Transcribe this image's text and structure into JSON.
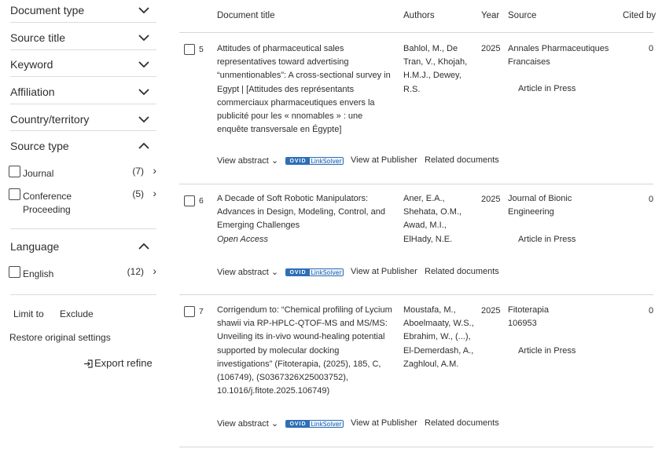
{
  "sidebar": {
    "facets": [
      {
        "label": "Document type",
        "expanded": false
      },
      {
        "label": "Source title",
        "expanded": false
      },
      {
        "label": "Keyword",
        "expanded": false
      },
      {
        "label": "Affiliation",
        "expanded": false
      },
      {
        "label": "Country/territory",
        "expanded": false
      },
      {
        "label": "Source type",
        "expanded": true
      },
      {
        "label": "Language",
        "expanded": true
      }
    ],
    "source_type_options": [
      {
        "label": "Journal",
        "count": "(7)"
      },
      {
        "label": "Conference Proceeding",
        "count": "(5)"
      }
    ],
    "language_options": [
      {
        "label": "English",
        "count": "(12)"
      }
    ],
    "limit_to": "Limit to",
    "exclude": "Exclude",
    "restore": "Restore original settings",
    "export_refine": "Export refine"
  },
  "table": {
    "headers": {
      "title": "Document title",
      "authors": "Authors",
      "year": "Year",
      "source": "Source",
      "cited": "Cited by"
    }
  },
  "actions": {
    "view_abstract": "View abstract",
    "ovid_left": "OVID",
    "ovid_right": "LinkSolver",
    "view_publisher": "View at Publisher",
    "related": "Related documents"
  },
  "results": [
    {
      "num": "5",
      "title": "Attitudes of pharmaceutical sales representatives toward advertising “unmentionables”: A cross-sectional survey in Egypt | [Attitudes des représentants commerciaux pharmaceutiques envers la publicité pour les « nnomables » : une enquête transversale en Égypte]",
      "open_access": "",
      "authors": "Bahlol, M., De Tran, V., Khojah, H.M.J., Dewey, R.S.",
      "year": "2025",
      "source": "Annales Pharmaceutiques Francaises",
      "status": "Article in Press",
      "cited": "0"
    },
    {
      "num": "6",
      "title": "A Decade of Soft Robotic Manipulators: Advances in Design, Modeling, Control, and Emerging Challenges",
      "open_access": "Open Access",
      "authors": "Aner, E.A., Shehata, O.M., Awad, M.I., ElHady, N.E.",
      "year": "2025",
      "source": "Journal of Bionic Engineering",
      "status": "Article in Press",
      "cited": "0"
    },
    {
      "num": "7",
      "title": "Corrigendum to: “Chemical profiling of Lycium shawii via RP-HPLC-QTOF-MS and MS/MS: Unveiling its in-vivo wound-healing potential supported by molecular docking investigations” (Fitoterapia, (2025), 185, C, (106749), (S0367326X25003752), 10.1016/j.fitote.2025.106749)",
      "open_access": "",
      "authors": "Moustafa, M., Aboelmaaty, W.S., Ebrahim, W., (...), El-Demerdash, A., Zaghloul, A.M.",
      "year": "2025",
      "source": "Fitoterapia 106953",
      "status": "Article in Press",
      "cited": "0"
    }
  ]
}
